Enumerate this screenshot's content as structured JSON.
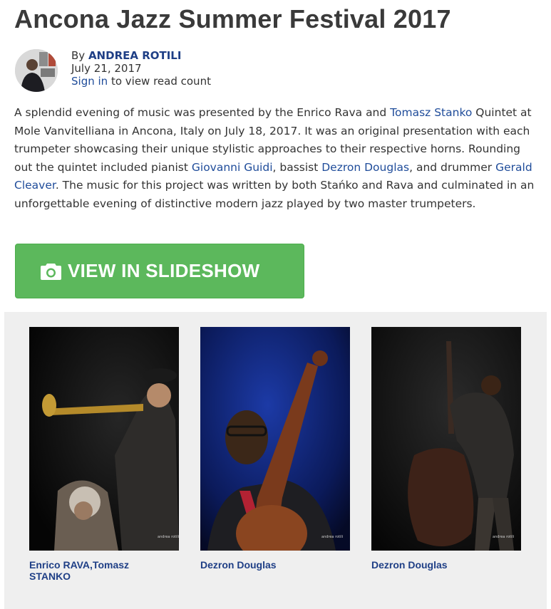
{
  "article": {
    "title": "Ancona Jazz Summer Festival 2017",
    "byline": {
      "by_label": "By",
      "author": "ANDREA ROTILI",
      "date": "July 21, 2017",
      "sign_in_link": "Sign in",
      "sign_in_suffix": "to view read count"
    },
    "body": {
      "t1": "A splendid evening of music was presented by the Enrico Rava and ",
      "l1": "Tomasz Stanko",
      "t2": " Quintet at Mole Vanvitelliana in Ancona, Italy on July 18, 2017. It was an original presentation with each trumpeter showcasing their unique stylistic approaches to their respective horns. Rounding out the quintet included pianist ",
      "l2": "Giovanni Guidi",
      "t3": ", bassist ",
      "l3": "Dezron Douglas",
      "t4": ", and drummer ",
      "l4": "Gerald Cleaver",
      "t5": ". The music for this project was written by both Stańko and Rava and culminated in an unforgettable evening of distinctive modern jazz played by two master trumpeters."
    }
  },
  "slideshow_button": {
    "label": "VIEW IN SLIDESHOW",
    "icon": "camera-icon",
    "color": "#5cb85c"
  },
  "gallery": {
    "watermark": "andrea rotili",
    "items": [
      {
        "caption": "Enrico RAVA,Tomasz STANKO"
      },
      {
        "caption": "Dezron Douglas"
      },
      {
        "caption": "Dezron Douglas"
      }
    ]
  },
  "colors": {
    "link": "#1f4c9a",
    "caption": "#1f3f86",
    "gallery_bg": "#efefef"
  }
}
